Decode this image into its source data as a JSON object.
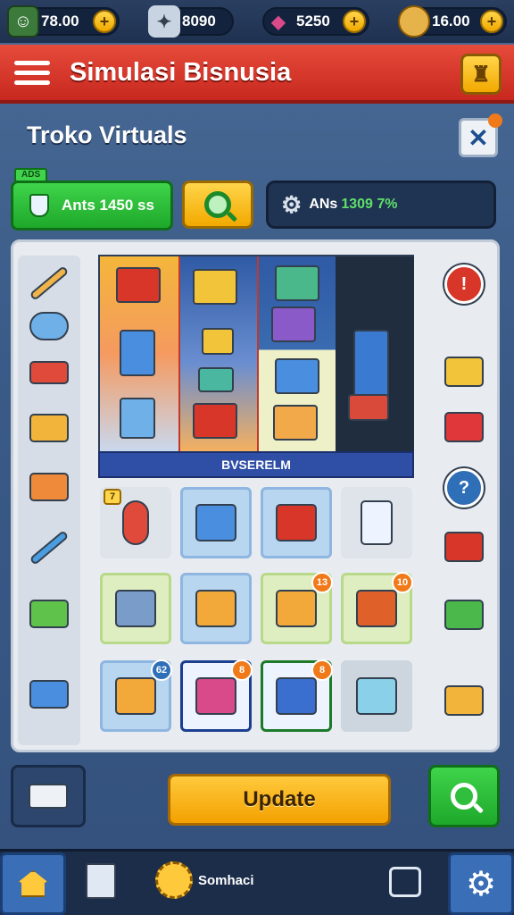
{
  "resources": [
    {
      "icon": "avatar-icon",
      "value": "78.00",
      "color": "#3c7a3c"
    },
    {
      "icon": "robot-icon",
      "value": "8090",
      "color": "#c9d4e2"
    },
    {
      "icon": "gem-icon",
      "value": "5250",
      "color": "#d94a8a"
    },
    {
      "icon": "coin-icon",
      "value": "16.00",
      "color": "#e6b24a"
    }
  ],
  "header": {
    "title": "Simulasi Bisnusia",
    "menu_icon": "hamburger-icon",
    "trophy_icon": "trophy-icon"
  },
  "store": {
    "subtitle": "Troko Virtuals",
    "close_icon": "close-icon"
  },
  "actions": {
    "ads_tag": "ADS",
    "ads_label": "Ants 1450 ss",
    "stats_label": "ANs",
    "stats_value": "1309 7%"
  },
  "featured_banner": "BVSERELM",
  "grid_badges": {
    "r1c1": "7",
    "r2c3": "13",
    "r2c4": "10",
    "r3c1": "62",
    "r3c2": "8",
    "r3c3": "8"
  },
  "buttons": {
    "update": "Update"
  },
  "nav": {
    "shop_label": "Somhaci"
  },
  "colors": {
    "accent_red": "#d9362a",
    "accent_yellow": "#f3b100",
    "accent_green": "#22b02f",
    "panel_bg": "#e8ecf1"
  }
}
